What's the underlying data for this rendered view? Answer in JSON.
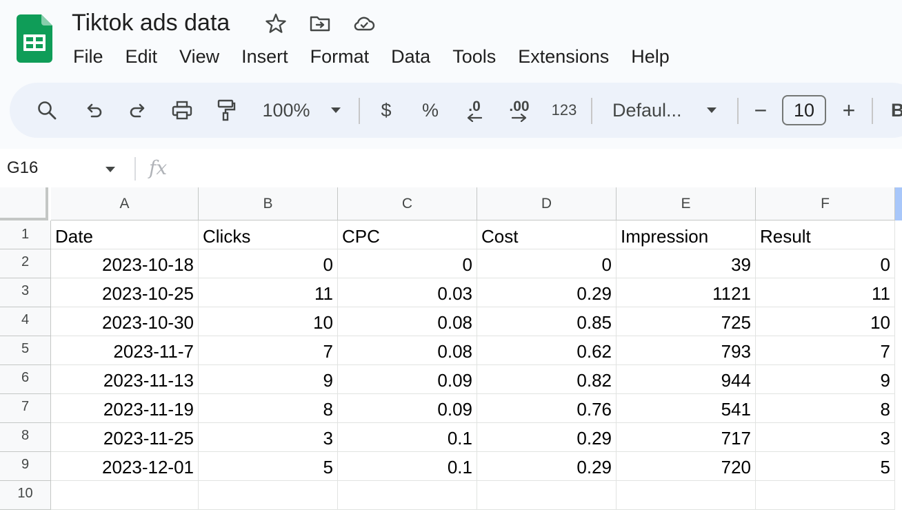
{
  "doc": {
    "title": "Tiktok ads data"
  },
  "menu": [
    "File",
    "Edit",
    "View",
    "Insert",
    "Format",
    "Data",
    "Tools",
    "Extensions",
    "Help"
  ],
  "toolbar": {
    "zoom": "100%",
    "currency": "$",
    "percent": "%",
    "dec_decrease": ".0",
    "dec_increase": ".00",
    "number_format": "123",
    "font": "Defaul...",
    "font_size": "10",
    "minus": "−",
    "plus": "+",
    "bold": "B"
  },
  "formula_bar": {
    "cell_ref": "G16",
    "fx": "fx",
    "value": ""
  },
  "sheet": {
    "columns": [
      "A",
      "B",
      "C",
      "D",
      "E",
      "F"
    ],
    "row_numbers": [
      "1",
      "2",
      "3",
      "4",
      "5",
      "6",
      "7",
      "8",
      "9",
      "10"
    ],
    "rows": [
      [
        "Date",
        "Clicks",
        "CPC",
        "Cost",
        "Impression",
        "Result"
      ],
      [
        "2023-10-18",
        "0",
        "0",
        "0",
        "39",
        "0"
      ],
      [
        "2023-10-25",
        "11",
        "0.03",
        "0.29",
        "1121",
        "11"
      ],
      [
        "2023-10-30",
        "10",
        "0.08",
        "0.85",
        "725",
        "10"
      ],
      [
        "2023-11-7",
        "7",
        "0.08",
        "0.62",
        "793",
        "7"
      ],
      [
        "2023-11-13",
        "9",
        "0.09",
        "0.82",
        "944",
        "9"
      ],
      [
        "2023-11-19",
        "8",
        "0.09",
        "0.76",
        "541",
        "8"
      ],
      [
        "2023-11-25",
        "3",
        "0.1",
        "0.29",
        "717",
        "3"
      ],
      [
        "2023-12-01",
        "5",
        "0.1",
        "0.29",
        "720",
        "5"
      ],
      [
        "",
        "",
        "",
        "",
        "",
        ""
      ]
    ]
  },
  "colors": {
    "sheets_green": "#0f9d58",
    "toolbar_bg": "#edf2fa",
    "accent_blue": "#a8c7fa"
  }
}
